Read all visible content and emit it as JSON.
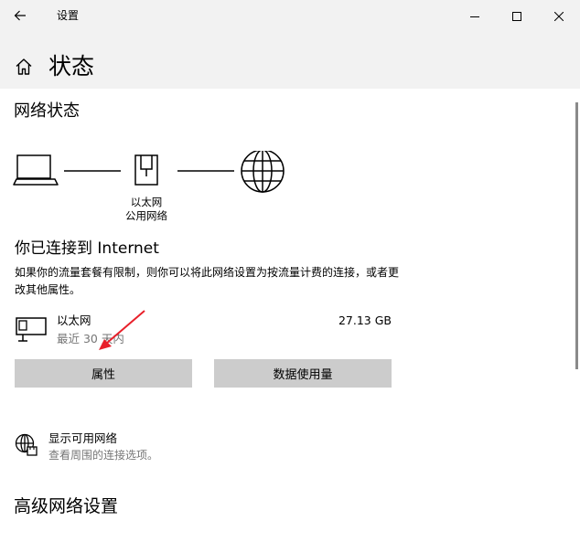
{
  "window": {
    "title": "设置",
    "back_icon": "arrow-left-icon",
    "minimize_icon": "minimize-icon",
    "maximize_icon": "maximize-icon",
    "close_icon": "close-icon"
  },
  "page": {
    "title": "状态",
    "home_icon": "home-icon"
  },
  "network_status": {
    "title": "网络状态",
    "adapter_name": "以太网",
    "network_type": "公用网络",
    "connection_heading": "你已连接到 Internet",
    "description": "如果你的流量套餐有限制，则你可以将此网络设置为按流量计费的连接，或者更改其他属性。"
  },
  "ethernet": {
    "name": "以太网",
    "period": "最近 30 天内",
    "usage": "27.13 GB"
  },
  "buttons": {
    "properties": "属性",
    "data_usage": "数据使用量"
  },
  "available_networks": {
    "title": "显示可用网络",
    "subtitle": "查看周围的连接选项。"
  },
  "advanced": {
    "title": "高级网络设置"
  },
  "colors": {
    "accent_arrow": "#e8202a",
    "header_bg": "#f2f2f2",
    "button_bg": "#cccccc",
    "secondary_text": "#767676"
  }
}
